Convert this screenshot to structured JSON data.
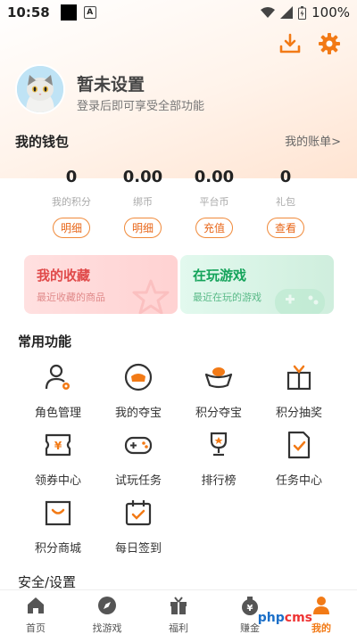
{
  "status_bar": {
    "time": "10:58",
    "battery": "100%"
  },
  "profile": {
    "name": "暂未设置",
    "subtitle": "登录后即可享受全部功能"
  },
  "wallet": {
    "title": "我的钱包",
    "link": "我的账单>",
    "items": [
      {
        "value": "0",
        "label": "我的积分",
        "button": "明细"
      },
      {
        "value": "0.00",
        "label": "绑币",
        "button": "明细"
      },
      {
        "value": "0.00",
        "label": "平台币",
        "button": "充值"
      },
      {
        "value": "0",
        "label": "礼包",
        "button": "查看"
      }
    ]
  },
  "cards": [
    {
      "title": "我的收藏",
      "subtitle": "最近收藏的商品"
    },
    {
      "title": "在玩游戏",
      "subtitle": "最近在玩的游戏"
    }
  ],
  "features": {
    "title": "常用功能",
    "items": [
      {
        "label": "角色管理",
        "icon": "user-gear-icon"
      },
      {
        "label": "我的夺宝",
        "icon": "treasure-icon"
      },
      {
        "label": "积分夺宝",
        "icon": "gold-ingot-icon"
      },
      {
        "label": "积分抽奖",
        "icon": "gift-box-icon"
      },
      {
        "label": "领券中心",
        "icon": "coupon-icon"
      },
      {
        "label": "试玩任务",
        "icon": "gamepad-icon"
      },
      {
        "label": "排行榜",
        "icon": "trophy-icon"
      },
      {
        "label": "任务中心",
        "icon": "task-doc-icon"
      },
      {
        "label": "积分商城",
        "icon": "shop-bag-icon"
      },
      {
        "label": "每日签到",
        "icon": "calendar-check-icon"
      }
    ]
  },
  "security": {
    "title": "安全/设置"
  },
  "nav": [
    {
      "label": "首页",
      "icon": "home-icon"
    },
    {
      "label": "找游戏",
      "icon": "compass-icon"
    },
    {
      "label": "福利",
      "icon": "gift-icon"
    },
    {
      "label": "赚金",
      "icon": "money-bag-icon"
    },
    {
      "label": "我的",
      "icon": "person-icon"
    }
  ],
  "watermark": {
    "a": "php",
    "b": "cms"
  },
  "colors": {
    "accent": "#f27a16",
    "fav_red": "#e04a4a",
    "play_green": "#14a35a"
  }
}
